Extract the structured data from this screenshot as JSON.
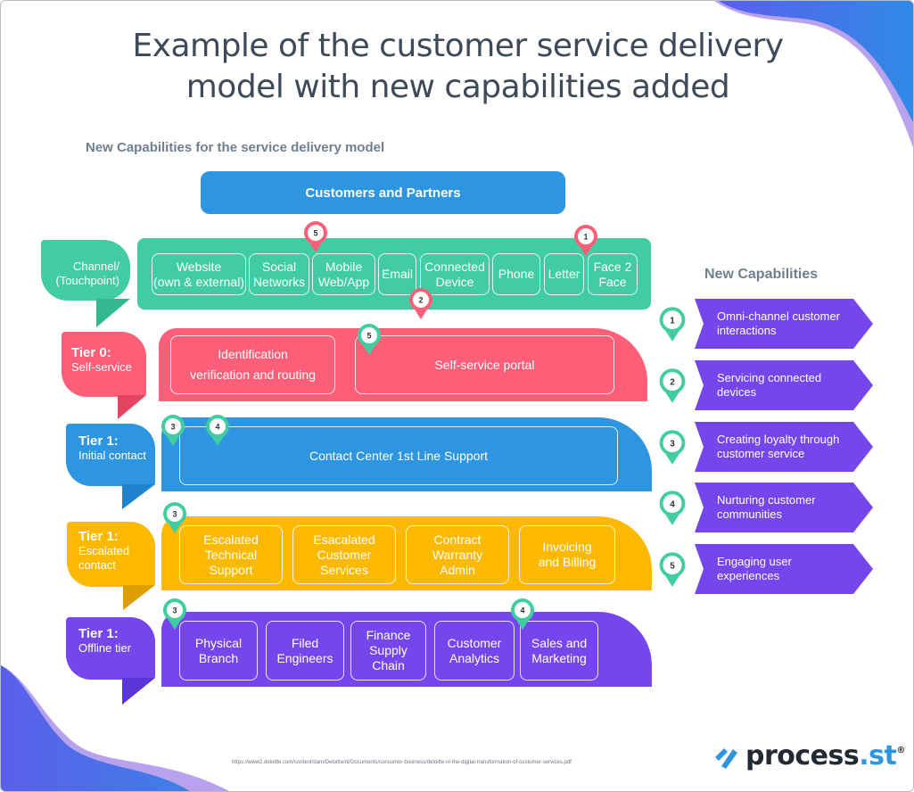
{
  "title_line1": "Example of the customer service delivery",
  "title_line2": "model with new capabilities added",
  "subtitle": "New Capabilities for the service delivery model",
  "customers_bar": "Customers and Partners",
  "colors": {
    "channel": "#41cda1",
    "tier0": "#fd5e78",
    "tier1_initial": "#2e96e0",
    "tier1_escalated": "#fdb900",
    "tier1_offline": "#7446ec",
    "capability": "#7446ec",
    "pin_red": "#fd5e78",
    "pin_green": "#41cda1",
    "heading_gray": "#6f7f8e",
    "title": "#3e4a59"
  },
  "channel": {
    "label": "Channel/\n(Touchpoint)",
    "label_line1": "Channel/",
    "label_line2": "(Touchpoint)",
    "items": [
      {
        "line1": "Website",
        "line2": "(own & external)"
      },
      {
        "line1": "Social",
        "line2": "Networks"
      },
      {
        "line1": "Mobile",
        "line2": "Web/App"
      },
      {
        "line1": "Email",
        "line2": ""
      },
      {
        "line1": "Connected",
        "line2": "Device"
      },
      {
        "line1": "Phone",
        "line2": ""
      },
      {
        "line1": "Letter",
        "line2": ""
      },
      {
        "line1": "Face 2",
        "line2": "Face"
      }
    ],
    "pins": [
      "5",
      "1",
      "2"
    ]
  },
  "tiers": [
    {
      "title": "Tier 0:",
      "subtitle": "Self-service",
      "boxes": [
        {
          "line1": "Identification",
          "line2": "verification and routing"
        },
        {
          "line1": "Self-service portal",
          "line2": ""
        }
      ],
      "pins": [
        "5"
      ]
    },
    {
      "title": "Tier 1:",
      "subtitle": "Initial contact",
      "boxes": [
        {
          "line1": "Contact Center 1st Line Support",
          "line2": ""
        }
      ],
      "pins": [
        "3",
        "4"
      ]
    },
    {
      "title": "Tier 1:",
      "subtitle_line1": "Escalated",
      "subtitle_line2": "contact",
      "boxes": [
        {
          "line1": "Escalated",
          "line2": "Technical",
          "line3": "Support"
        },
        {
          "line1": "Esacalated",
          "line2": "Customer",
          "line3": "Services"
        },
        {
          "line1": "Contract",
          "line2": "Warranty",
          "line3": "Admin"
        },
        {
          "line1": "Invoicing",
          "line2": "and Billing",
          "line3": ""
        }
      ],
      "pins": [
        "3"
      ]
    },
    {
      "title": "Tier 1:",
      "subtitle": "Offline tier",
      "boxes": [
        {
          "line1": "Physical",
          "line2": "Branch",
          "line3": ""
        },
        {
          "line1": "Filed",
          "line2": "Engineers",
          "line3": ""
        },
        {
          "line1": "Finance",
          "line2": "Supply",
          "line3": "Chain"
        },
        {
          "line1": "Customer",
          "line2": "Analytics",
          "line3": ""
        },
        {
          "line1": "Sales and",
          "line2": "Marketing",
          "line3": ""
        }
      ],
      "pins": [
        "3",
        "4"
      ]
    }
  ],
  "new_capabilities": {
    "heading": "New Capabilities",
    "items": [
      {
        "num": "1",
        "line1": "Omni-channel customer",
        "line2": "interactions"
      },
      {
        "num": "2",
        "line1": "Servicing connected",
        "line2": "devices"
      },
      {
        "num": "3",
        "line1": "Creating loyalty through",
        "line2": "customer service"
      },
      {
        "num": "4",
        "line1": "Nurturing customer",
        "line2": "communities"
      },
      {
        "num": "5",
        "line1": "Engaging user",
        "line2": "experiences"
      }
    ]
  },
  "source_url": "https://www2.deloitte.com/content/dam/Deloitte/nl/Documents/consumer-business/deloitte-nl-the-digital-transformation-of-customer-services.pdf",
  "logo": {
    "name": "process",
    "suffix": ".st",
    "mark": "®"
  }
}
